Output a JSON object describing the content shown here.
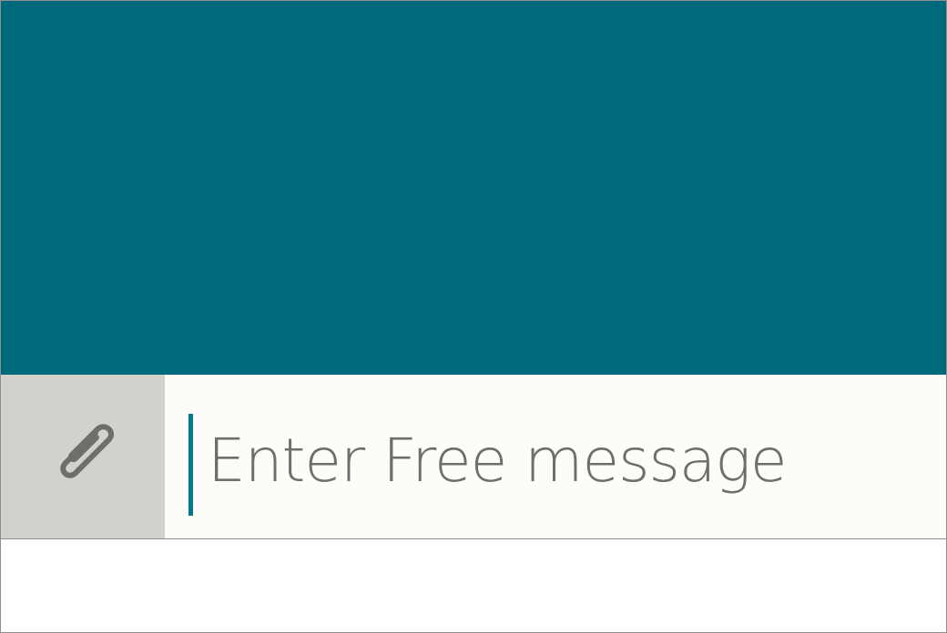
{
  "theme": {
    "header_color": "#00697b",
    "composer_background": "#fdfcf8",
    "attach_background": "#d2d1cb",
    "caret_color": "#00788d",
    "placeholder_color": "#6f6e6a"
  },
  "composer": {
    "attach_icon": "paperclip-icon",
    "message_placeholder": "Enter Free message"
  }
}
